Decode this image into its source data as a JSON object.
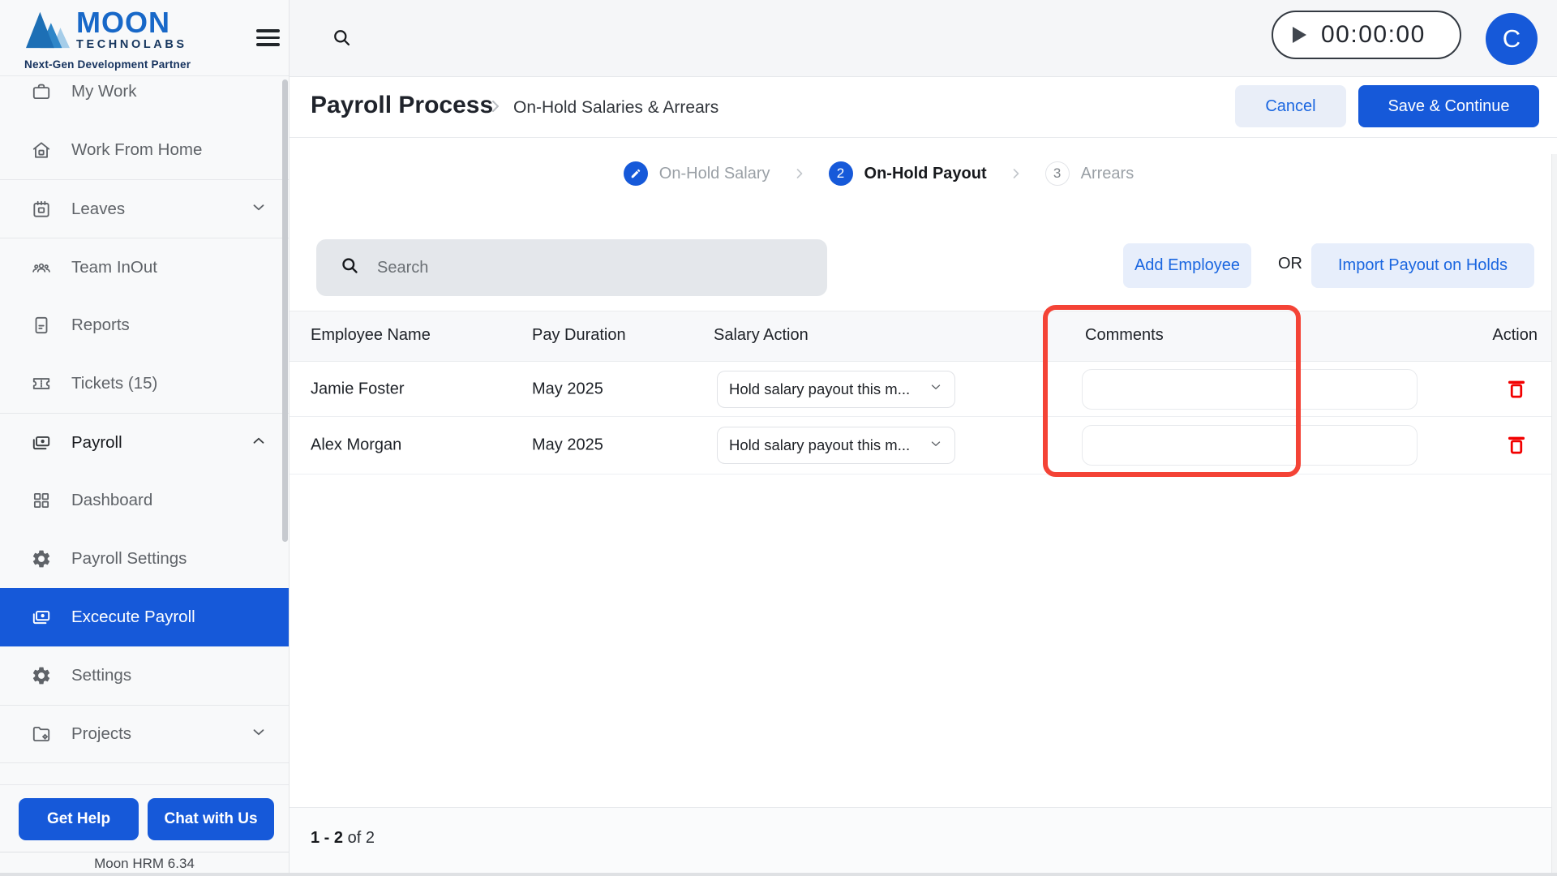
{
  "brand": {
    "name": "MOON",
    "sub": "TECHNOLABS",
    "tagline": "Next-Gen Development Partner",
    "version": "Moon HRM 6.34"
  },
  "sidebar": {
    "items": [
      {
        "label": "My Work",
        "icon": "briefcase-icon"
      },
      {
        "label": "Work From Home",
        "icon": "home-icon"
      },
      {
        "label": "Leaves",
        "icon": "calendar-icon",
        "chevron": "down"
      },
      {
        "label": "Team InOut",
        "icon": "people-icon"
      },
      {
        "label": "Reports",
        "icon": "document-icon"
      },
      {
        "label": "Tickets (15)",
        "icon": "ticket-icon"
      },
      {
        "label": "Payroll",
        "icon": "payments-icon",
        "chevron": "up",
        "expanded": true
      },
      {
        "label": "Dashboard",
        "icon": "dashboard-icon"
      },
      {
        "label": "Payroll Settings",
        "icon": "gear-icon"
      },
      {
        "label": "Excecute Payroll",
        "icon": "payments-icon",
        "selected": true
      },
      {
        "label": "Settings",
        "icon": "gear-icon"
      },
      {
        "label": "Projects",
        "icon": "folder-gear-icon",
        "chevron": "down"
      }
    ],
    "get_help": "Get Help",
    "chat": "Chat with Us"
  },
  "topbar": {
    "timer": "00:00:00",
    "avatar_initial": "C",
    "icons": [
      "search-icon",
      "play-icon"
    ]
  },
  "page_header": {
    "title": "Payroll Process",
    "breadcrumb": "On-Hold Salaries & Arrears",
    "cancel": "Cancel",
    "save": "Save & Continue"
  },
  "stepper": {
    "steps": [
      {
        "num": "1",
        "label": "On-Hold Salary",
        "state": "done",
        "icon": "pencil-icon"
      },
      {
        "num": "2",
        "label": "On-Hold Payout",
        "state": "active"
      },
      {
        "num": "3",
        "label": "Arrears",
        "state": "upcoming"
      }
    ]
  },
  "toolbar": {
    "search_placeholder": "Search",
    "add_employee": "Add Employee",
    "or": "OR",
    "import_payout": "Import Payout on Holds"
  },
  "table": {
    "columns": {
      "name": "Employee Name",
      "duration": "Pay Duration",
      "salary_action": "Salary Action",
      "comments": "Comments",
      "action": "Action"
    },
    "rows": [
      {
        "name": "Jamie Foster",
        "duration": "May 2025",
        "salary_action": "Hold salary payout this m...",
        "comment": ""
      },
      {
        "name": "Alex Morgan",
        "duration": "May 2025",
        "salary_action": "Hold salary payout this m...",
        "comment": ""
      }
    ],
    "pagination": {
      "range": "1 - 2",
      "of": " of 2"
    }
  },
  "annotations": {
    "comments_highlight": "red rounded rectangle around Comments column"
  },
  "colors": {
    "accent_blue": "#1659d9",
    "link_blue": "#1a66e0",
    "light_blue_button": "#e7eefb",
    "danger_red": "#f20000",
    "highlight_red": "#f44336",
    "sidebar_bg": "#f8f9fa",
    "topbar_bg": "#f5f6f8",
    "table_header_bg": "#f7f8fa"
  }
}
